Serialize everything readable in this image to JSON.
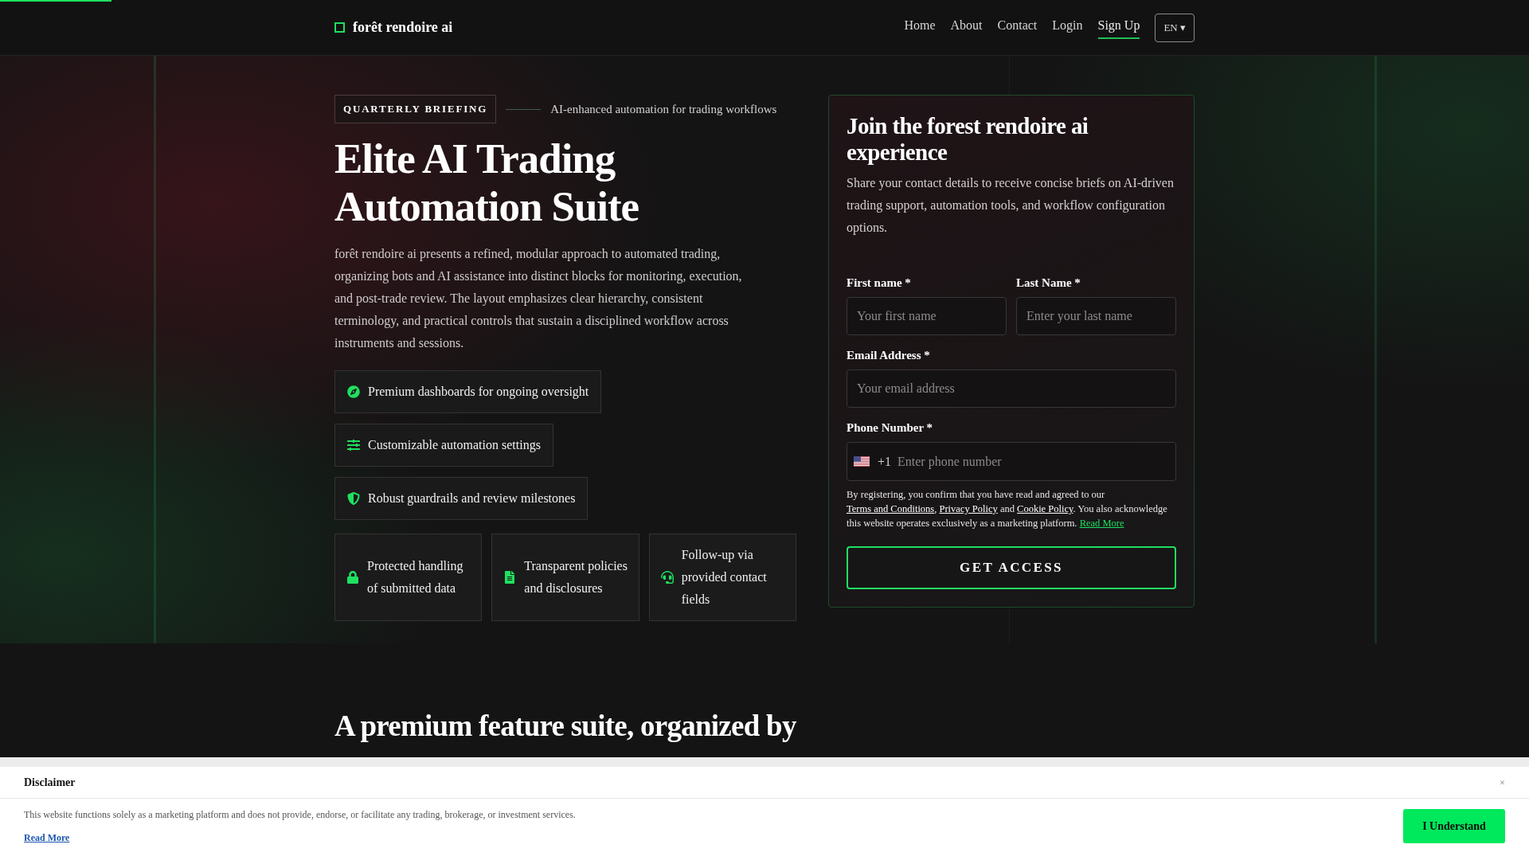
{
  "header": {
    "brand": "forêt rendoire ai",
    "nav": [
      {
        "label": "Home",
        "selected": false
      },
      {
        "label": "About",
        "selected": false
      },
      {
        "label": "Contact",
        "selected": false
      },
      {
        "label": "Login",
        "selected": false
      },
      {
        "label": "Sign Up",
        "selected": true
      }
    ],
    "language": "EN ▾"
  },
  "hero": {
    "badge": "QUARTERLY BRIEFING",
    "tagline": "AI-enhanced automation for trading workflows",
    "title": "Elite AI Trading Automation Suite",
    "description": "forêt rendoire ai presents a refined, modular approach to automated trading, organizing bots and AI assistance into distinct blocks for monitoring, execution, and post-trade review. The layout emphasizes clear hierarchy, consistent terminology, and practical controls that sustain a disciplined workflow across instruments and sessions.",
    "highlights": [
      "Premium dashboards for ongoing oversight",
      "Customizable automation settings",
      "Robust guardrails and review milestones"
    ],
    "assurances": [
      "Protected handling of submitted data",
      "Transparent policies and disclosures",
      "Follow-up via provided contact fields"
    ]
  },
  "signup_form": {
    "title": "Join the forest rendoire ai experience",
    "description": "Share your contact details to receive concise briefs on AI-driven trading support, automation tools, and workflow configuration options.",
    "name_fields": [
      {
        "label": "First name *",
        "placeholder": "Your first name"
      },
      {
        "label": "Last Name *",
        "placeholder": "Enter your last name"
      }
    ],
    "email": {
      "label": "Email Address *",
      "placeholder": "Your email address"
    },
    "phone": {
      "label": "Phone Number *",
      "country_code": "+1",
      "placeholder": "Enter phone number"
    },
    "consent": [
      {
        "kind": "text",
        "text": "By registering, you confirm that you have read and agreed to our "
      },
      {
        "kind": "link",
        "text": "Terms and Conditions"
      },
      {
        "kind": "text",
        "text": ", "
      },
      {
        "kind": "link",
        "text": "Privacy Policy"
      },
      {
        "kind": "text",
        "text": " and "
      },
      {
        "kind": "link",
        "text": "Cookie Policy"
      },
      {
        "kind": "text",
        "text": ". You also acknowledge this website operates exclusively as a marketing platform. "
      },
      {
        "kind": "accent",
        "text": "Read More"
      }
    ],
    "submit": "GET ACCESS"
  },
  "features_section": {
    "title": "A premium feature suite, organized by"
  },
  "disclaimer": {
    "title": "Disclaimer",
    "close": "×",
    "text": "This website functions solely as a marketing platform and does not provide, endorse, or facilitate any trading, brokerage, or investment services.",
    "read_more": "Read More",
    "button": "I Understand"
  }
}
